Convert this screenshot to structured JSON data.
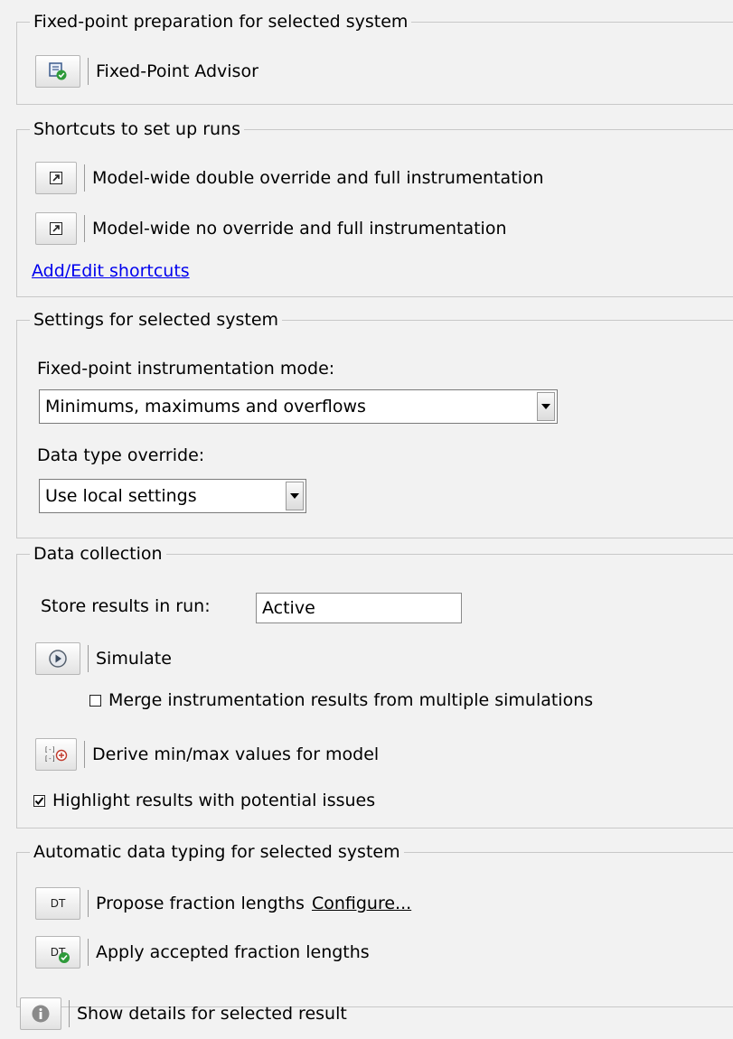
{
  "prep": {
    "title": "Fixed-point preparation for selected system",
    "advisor_label": "Fixed-Point Advisor"
  },
  "shortcuts": {
    "title": "Shortcuts to set up runs",
    "items": [
      {
        "label": "Model-wide double override and full instrumentation"
      },
      {
        "label": "Model-wide no override and full instrumentation"
      }
    ],
    "add_edit_link": "Add/Edit shortcuts"
  },
  "settings": {
    "title": "Settings for selected system",
    "instrumentation_label": "Fixed-point instrumentation mode:",
    "instrumentation_value": "Minimums, maximums and overflows",
    "dto_label": "Data type override:",
    "dto_value": "Use local settings"
  },
  "data_collection": {
    "title": "Data collection",
    "store_label": "Store results in run:",
    "store_value": "Active",
    "simulate_label": "Simulate",
    "merge_label": "Merge instrumentation results from multiple simulations",
    "merge_checked": false,
    "derive_label": "Derive min/max values for model",
    "highlight_label": "Highlight results with potential issues",
    "highlight_checked": true
  },
  "auto_typing": {
    "title": "Automatic data typing for selected system",
    "propose_label": "Propose fraction lengths",
    "propose_icon_text": "DT",
    "configure_link": "Configure...",
    "apply_label": "Apply accepted fraction lengths",
    "apply_icon_text": "DT"
  },
  "details": {
    "label": "Show details for selected result"
  },
  "colors": {
    "link": "#0000ee",
    "panel_bg": "#f2f2f2",
    "check_green": "#2e9a3a"
  },
  "icons": {
    "advisor": "fixed-point-advisor-icon",
    "shortcut": "shortcut-arrow-icon",
    "simulate": "play-icon",
    "derive": "derive-range-icon",
    "propose": "dt-icon",
    "apply": "dt-check-icon",
    "details": "info-icon"
  }
}
